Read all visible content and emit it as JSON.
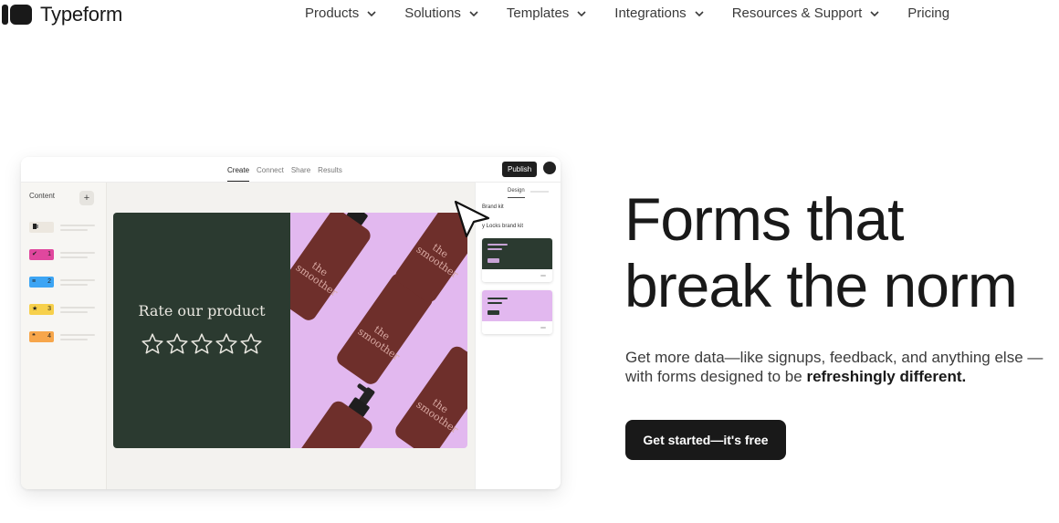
{
  "brand": {
    "name": "Typeform"
  },
  "nav": [
    {
      "label": "Products",
      "has_dropdown": true
    },
    {
      "label": "Solutions",
      "has_dropdown": true
    },
    {
      "label": "Templates",
      "has_dropdown": true
    },
    {
      "label": "Integrations",
      "has_dropdown": true
    },
    {
      "label": "Resources & Support",
      "has_dropdown": true
    },
    {
      "label": "Pricing",
      "has_dropdown": false
    }
  ],
  "mockup": {
    "tabs": [
      "Create",
      "Connect",
      "Share",
      "Results"
    ],
    "active_tab": "Create",
    "publish_label": "Publish",
    "sidebar_title": "Content",
    "add_label": "+",
    "questions": [
      {
        "number": "",
        "icon": "statement-icon",
        "color": "#ece7df"
      },
      {
        "number": "1",
        "icon": "check-icon",
        "color": "#e0479e"
      },
      {
        "number": "2",
        "icon": "text-icon",
        "color": "#3da5f4"
      },
      {
        "number": "3",
        "icon": "star-icon",
        "color": "#f7d04b"
      },
      {
        "number": "4",
        "icon": "quote-icon",
        "color": "#f7a64b"
      }
    ],
    "card": {
      "question": "Rate our product",
      "star_count": 5,
      "bottle_label": "the smoother"
    },
    "design_panel": {
      "tab": "Design",
      "brand_kit_label": "Brand kit",
      "brand_kit_name": "y Locks brand kit",
      "themes": [
        {
          "bg": "#2b3a30",
          "accent": "#c7a3d6"
        },
        {
          "bg": "#e2b8ef",
          "accent": "#2b3a30"
        }
      ]
    }
  },
  "hero": {
    "headline_line1": "Forms that",
    "headline_line2": "break the norm",
    "sub_text": "Get more data—like signups, feedback, and anything else —with forms designed to be ",
    "sub_bold": "refreshingly different.",
    "cta_label": "Get started—it's free"
  }
}
